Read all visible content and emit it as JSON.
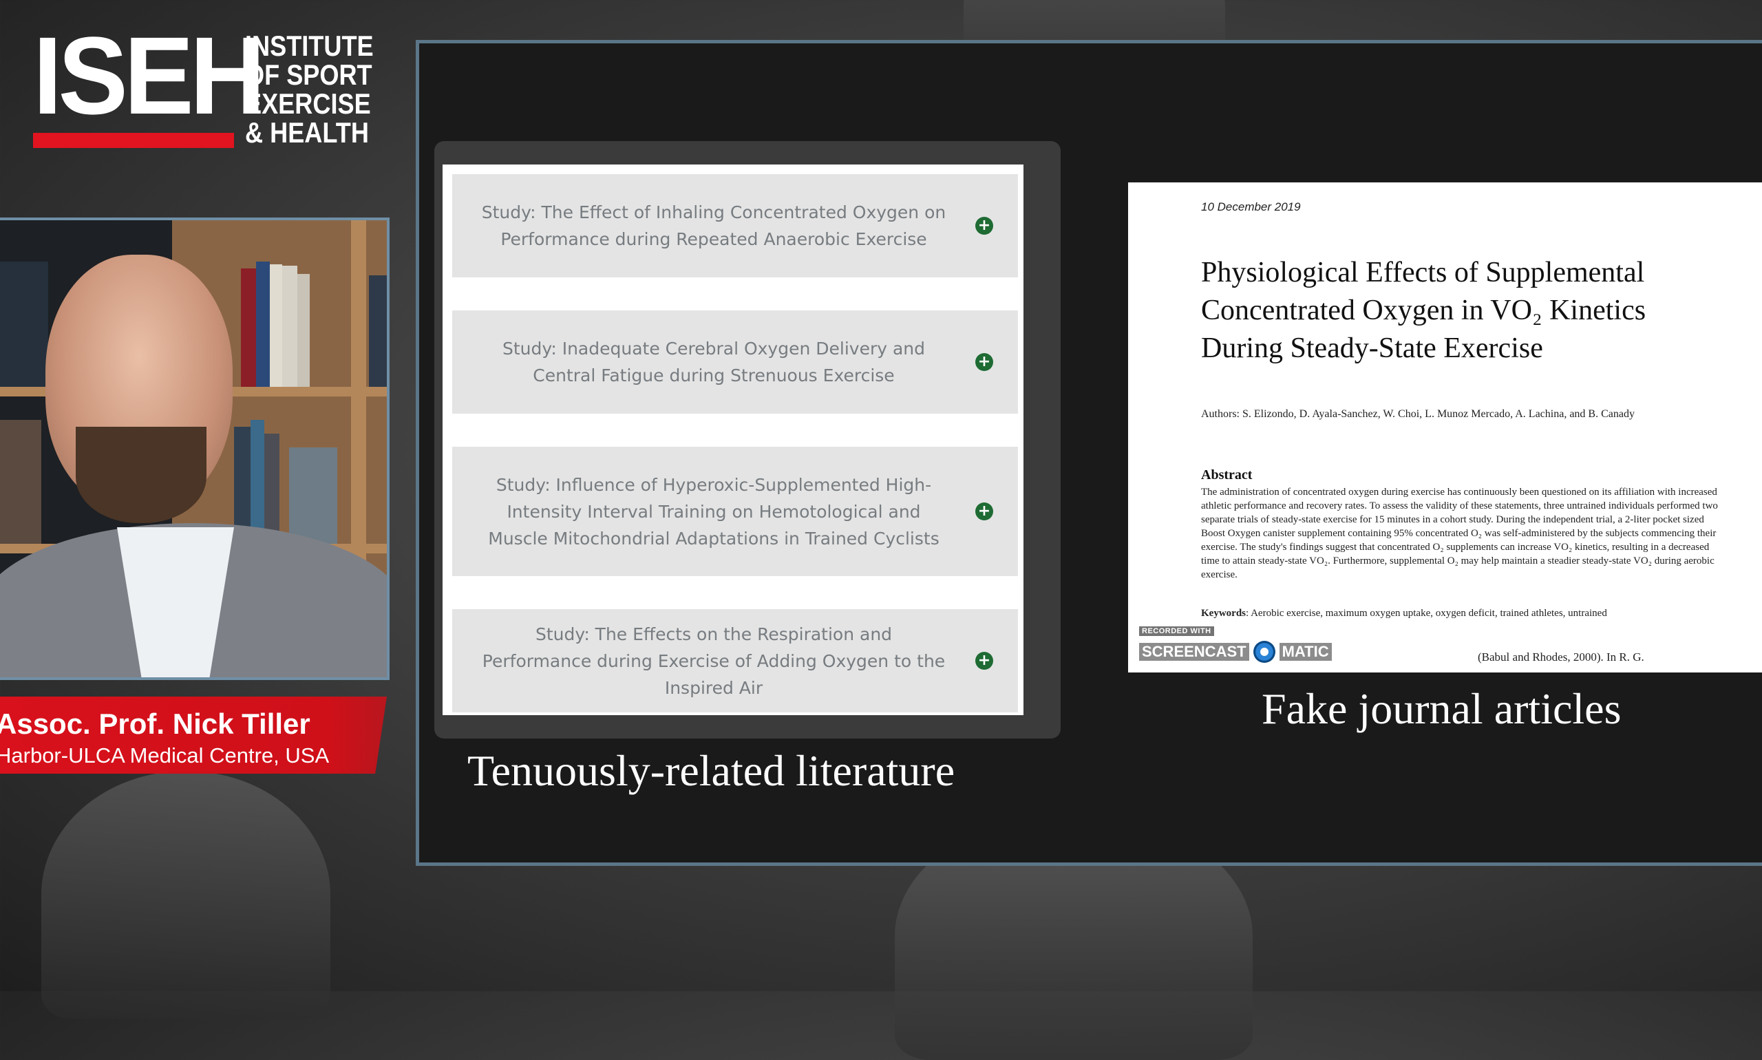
{
  "logo": {
    "mark": "ISEH",
    "lines": [
      "INSTITUTE",
      "OF SPORT",
      "EXERCISE",
      "& HEALTH"
    ],
    "accent_color": "#e1141f"
  },
  "speaker": {
    "name": "Assoc. Prof. Nick Tiller",
    "affiliation": "Harbor-ULCA Medical Centre, USA",
    "nameplate_color": "#d8111c"
  },
  "slide": {
    "studies": [
      {
        "title": "Study: The Effect of Inhaling Concentrated Oxygen on Performance during Repeated Anaerobic Exercise",
        "icon": "plus-icon"
      },
      {
        "title": "Study: Inadequate Cerebral Oxygen Delivery and Central Fatigue during Strenuous Exercise",
        "icon": "plus-icon"
      },
      {
        "title": "Study: Influence of Hyperoxic-Supplemented High-Intensity Interval Training on Hemotological and Muscle Mitochondrial Adaptations in Trained Cyclists",
        "icon": "plus-icon"
      },
      {
        "title": "Study: The Effects on the Respiration and Performance during Exercise of Adding Oxygen to the Inspired Air",
        "icon": "plus-icon"
      }
    ],
    "left_caption": "Tenuously-related literature",
    "right_caption": "Fake journal articles",
    "plus_color": "#1e6b33",
    "paper": {
      "date": "10 December 2019",
      "title_lines": [
        "Physiological Effects of Supplemental",
        "Concentrated Oxygen in VO₂ Kinetics",
        "During Steady-State Exercise"
      ],
      "authors": "Authors: S. Elizondo, D. Ayala-Sanchez, W. Choi, L. Munoz Mercado, A. Lachina, and B. Canady",
      "abstract_heading": "Abstract",
      "abstract_text": "The administration of concentrated oxygen during exercise has continuously been questioned on its affiliation with increased athletic performance and recovery rates. To assess the validity of these statements, three untrained individuals performed two separate trials of steady-state exercise for 15 minutes in a cohort study. During the independent trial, a 2-liter pocket sized Boost Oxygen canister supplement containing 95% concentrated O₂ was self-administered by the subjects commencing their exercise. The study's findings suggest that concentrated O₂ supplements can increase VO₂ kinetics, resulting in a decreased time to attain steady-state VO₂. Furthermore, supplemental O₂ may help maintain a steadier steady-state VO₂ during aerobic exercise.",
      "keywords_label": "Keywords",
      "keywords_text": ": Aerobic exercise, maximum oxygen uptake, oxygen deficit, trained athletes, untrained",
      "citation_fragment": "(Babul and Rhodes, 2000). In R. G."
    },
    "watermark": {
      "small": "RECORDED WITH",
      "left": "SCREENCAST",
      "right": "MATIC"
    }
  }
}
